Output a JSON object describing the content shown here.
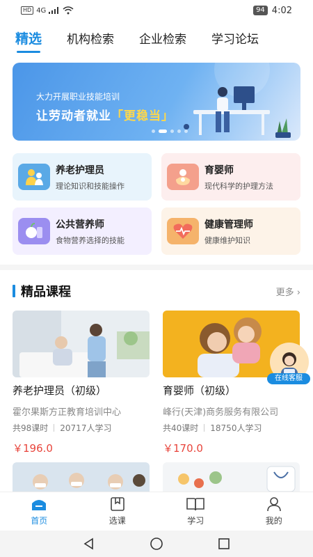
{
  "status_bar": {
    "network": "HD",
    "signal": "4G",
    "battery": "94",
    "time": "4:02"
  },
  "tabs": [
    {
      "label": "精选",
      "active": true
    },
    {
      "label": "机构检索",
      "active": false
    },
    {
      "label": "企业检索",
      "active": false
    },
    {
      "label": "学习论坛",
      "active": false
    }
  ],
  "banner": {
    "line1": "大力开展职业技能培训",
    "line2_prefix": "让劳动者就业",
    "line2_highlight": "「更稳当」"
  },
  "categories": [
    {
      "title": "养老护理员",
      "subtitle": "理论知识和技能操作",
      "icon": "elderly-care-icon",
      "bg": "#e8f4fc",
      "icon_bg": "#5aa9e6"
    },
    {
      "title": "育婴师",
      "subtitle": "现代科学的护理方法",
      "icon": "infant-care-icon",
      "bg": "#fdeeee",
      "icon_bg": "#f4a08c"
    },
    {
      "title": "公共营养师",
      "subtitle": "食物营养选择的技能",
      "icon": "nutrition-icon",
      "bg": "#f3efff",
      "icon_bg": "#9b8ef0"
    },
    {
      "title": "健康管理师",
      "subtitle": "健康维护知识",
      "icon": "health-heart-icon",
      "bg": "#fdf3e8",
      "icon_bg": "#f5b36b"
    }
  ],
  "section": {
    "title": "精品课程",
    "more": "更多"
  },
  "courses": [
    {
      "name": "养老护理员（初级）",
      "org": "霍尔果斯方正教育培训中心",
      "lessons": "共98课时",
      "learners": "20717人学习",
      "price": "￥196.0"
    },
    {
      "name": "育婴师（初级）",
      "org": "峰行(天津)商务服务有限公司",
      "lessons": "共40课时",
      "learners": "18750人学习",
      "price": "￥170.0"
    }
  ],
  "service": {
    "label": "在线客服"
  },
  "bottom_nav": [
    {
      "label": "首页",
      "icon": "home-icon",
      "active": true
    },
    {
      "label": "选课",
      "icon": "bookmark-book-icon",
      "active": false
    },
    {
      "label": "学习",
      "icon": "open-book-icon",
      "active": false
    },
    {
      "label": "我的",
      "icon": "user-icon",
      "active": false
    }
  ],
  "colors": {
    "accent": "#1b8ce0",
    "price": "#e8453c"
  }
}
